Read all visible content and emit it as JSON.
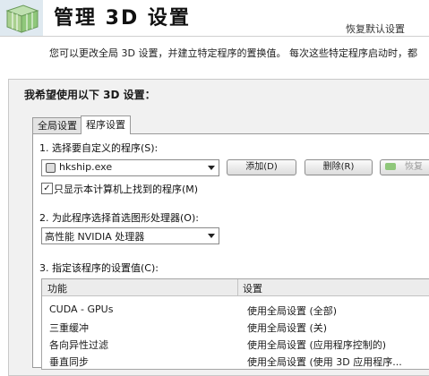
{
  "header": {
    "title": "管理 3D 设置",
    "restore_link": "恢复默认设置",
    "description": "您可以更改全局 3D 设置，并建立特定程序的置换值。 每次这些特定程序启动时，都"
  },
  "panel": {
    "section_label": "我希望使用以下 3D 设置：",
    "tabs": [
      {
        "label": "全局设置"
      },
      {
        "label": "程序设置"
      }
    ],
    "step1": {
      "label": "1. 选择要自定义的程序(S):",
      "program": "hkship.exe",
      "add_button": "添加(D)",
      "delete_button": "删除(R)",
      "restore_button": "恢复",
      "checkbox_label": "只显示本计算机上找到的程序(M)",
      "checkbox_mark": "✓"
    },
    "step2": {
      "label": "2. 为此程序选择首选图形处理器(O):",
      "value": "高性能 NVIDIA 处理器"
    },
    "step3": {
      "label": "3. 指定该程序的设置值(C):",
      "columns": [
        "功能",
        "设置"
      ],
      "rows": [
        {
          "feature": "CUDA - GPUs",
          "setting": "使用全局设置 (全部)"
        },
        {
          "feature": "三重缓冲",
          "setting": "使用全局设置 (关)"
        },
        {
          "feature": "各向异性过滤",
          "setting": "使用全局设置 (应用程序控制的)"
        },
        {
          "feature": "垂直同步",
          "setting": "使用全局设置 (使用 3D 应用程序..."
        }
      ]
    }
  },
  "colors": {
    "accent_green": "#8fc77a",
    "panel_bg": "#f1f1f1"
  },
  "icons": {
    "logo": "nvidia-3d-cube-icon",
    "program": "program-icon",
    "dropdown": "chevron-down-icon"
  }
}
